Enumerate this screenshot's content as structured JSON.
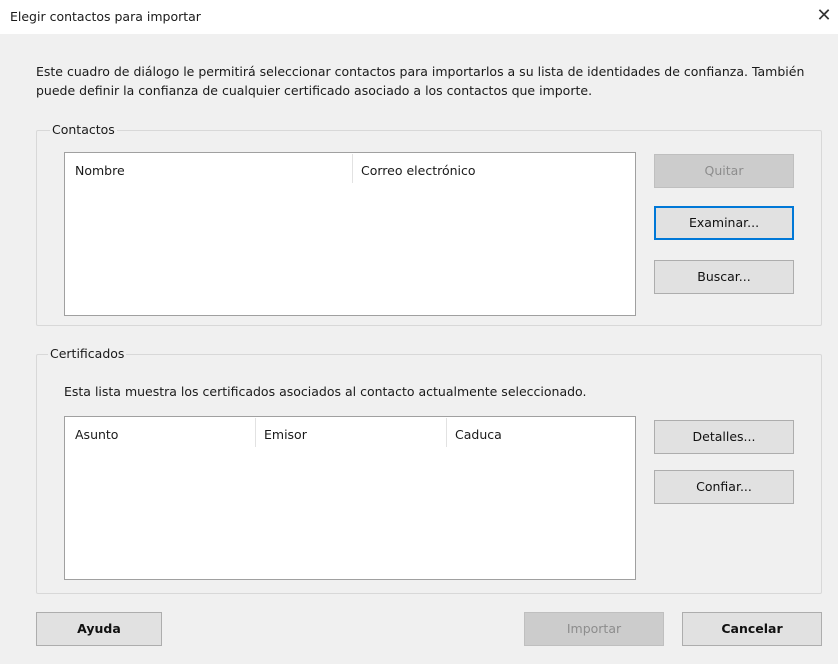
{
  "window": {
    "title": "Elegir contactos para importar"
  },
  "intro": "Este cuadro de diálogo le permitirá seleccionar contactos para importarlos a su lista de identidades de confianza. También puede definir la confianza de cualquier certificado asociado a los contactos que importe.",
  "contacts": {
    "group_label": "Contactos",
    "columns": [
      "Nombre",
      "Correo electrónico"
    ],
    "rows": [],
    "buttons": {
      "remove": "Quitar",
      "browse": "Examinar...",
      "search": "Buscar..."
    }
  },
  "certificates": {
    "group_label": "Certificados",
    "hint": "Esta lista muestra los certificados asociados al contacto actualmente seleccionado.",
    "columns": [
      "Asunto",
      "Emisor",
      "Caduca"
    ],
    "rows": [],
    "buttons": {
      "details": "Detalles...",
      "trust": "Confiar..."
    }
  },
  "footer": {
    "help": "Ayuda",
    "import": "Importar",
    "cancel": "Cancelar"
  }
}
